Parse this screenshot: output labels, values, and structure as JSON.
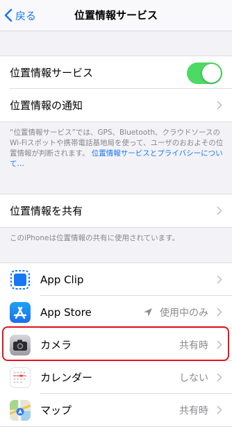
{
  "nav": {
    "back_label": "戻る",
    "title": "位置情報サービス"
  },
  "location_group": {
    "location_services_label": "位置情報サービス",
    "location_services_on": true,
    "notification_label": "位置情報の通知"
  },
  "description": {
    "text": "“位置情報サービス”では、GPS、Bluetooth、クラウドソースのWi-Fiスポットや携帯電話基地局を使って、ユーザのおおよその位置情報が判断されます。",
    "link": "位置情報サービスとプライバシーについて…"
  },
  "share_group": {
    "label": "位置情報を共有",
    "note": "このiPhoneは位置情報の共有に使用されています。"
  },
  "apps": [
    {
      "name": "App Clip",
      "value": "",
      "icon": "app-clip-icon"
    },
    {
      "name": "App Store",
      "value": "使用中のみ",
      "icon": "app-store-icon",
      "arrow": true
    },
    {
      "name": "カメラ",
      "value": "共有時",
      "icon": "camera-icon"
    },
    {
      "name": "カレンダー",
      "value": "しない",
      "icon": "calendar-icon"
    },
    {
      "name": "マップ",
      "value": "共有時",
      "icon": "maps-icon"
    }
  ],
  "colors": {
    "accent": "#1877f2",
    "toggle_on": "#4cd964",
    "highlight": "#e0141e"
  }
}
